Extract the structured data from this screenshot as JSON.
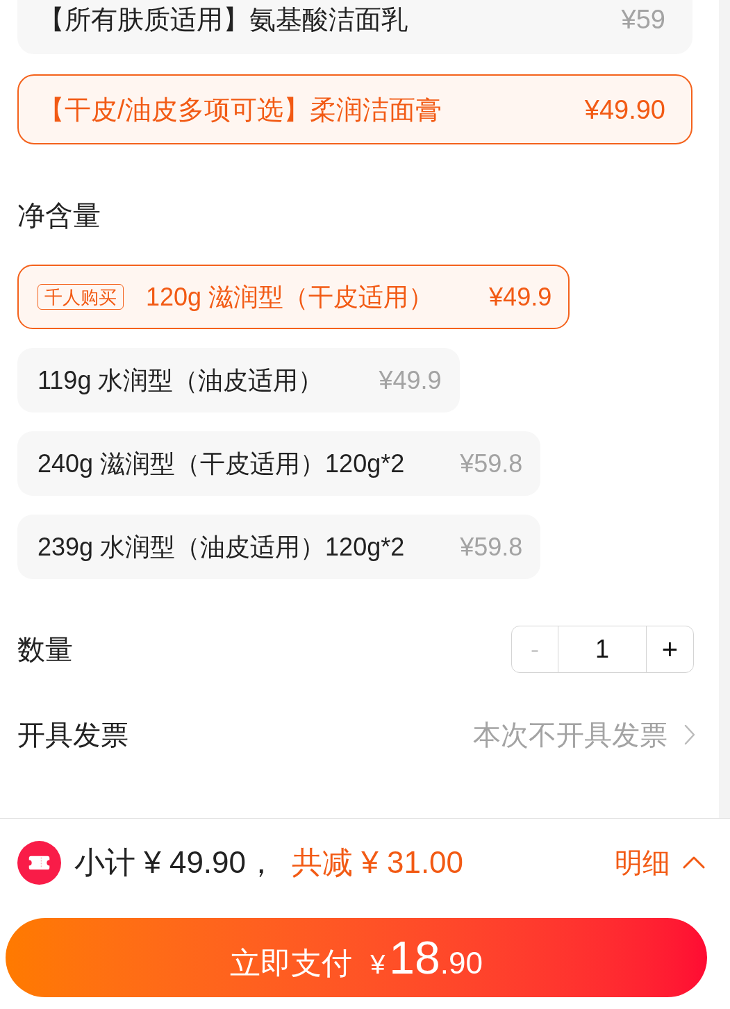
{
  "style_options": [
    {
      "name": "【所有肤质适用】氨基酸洁面乳",
      "price": "¥59",
      "selected": false
    },
    {
      "name": "【干皮/油皮多项可选】柔润洁面膏",
      "price": "¥49.90",
      "selected": true
    }
  ],
  "net_content": {
    "label": "净含量",
    "options": [
      {
        "tag": "千人购买",
        "name": "120g 滋润型（干皮适用）",
        "price": "¥49.9",
        "selected": true
      },
      {
        "name": "119g 水润型（油皮适用）",
        "price": "¥49.9",
        "selected": false
      },
      {
        "name": "240g 滋润型（干皮适用）120g*2",
        "price": "¥59.8",
        "selected": false
      },
      {
        "name": "239g 水润型（油皮适用）120g*2",
        "price": "¥59.8",
        "selected": false
      }
    ]
  },
  "quantity": {
    "label": "数量",
    "decrease": {
      "symbol": "-",
      "disabled": true
    },
    "value": "1",
    "increase": {
      "symbol": "+",
      "disabled": false
    }
  },
  "invoice": {
    "label": "开具发票",
    "value": "本次不开具发票"
  },
  "summary": {
    "subtotal": "小计 ¥ 49.90，",
    "discount": "共减 ¥ 31.00",
    "details": "明细"
  },
  "pay_button": {
    "label": "立即支付",
    "currency": "¥",
    "amount": "18",
    "decimals": ".90"
  }
}
